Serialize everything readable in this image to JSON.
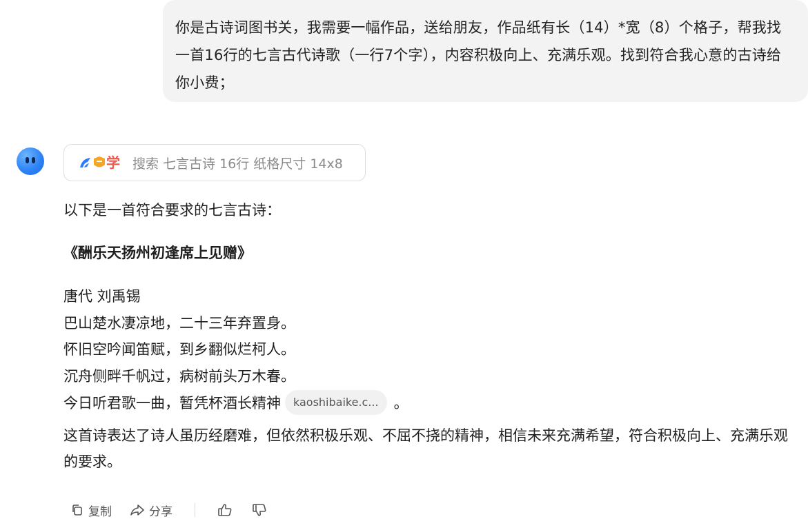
{
  "user_message": {
    "text": "你是古诗词图书关，我需要一幅作品，送给朋友，作品纸有长（14）*宽（8）个格子，帮我找一首16行的七言古代诗歌（一行7个字），内容积极向上、充满乐观。找到符合我心意的古诗给你小费；"
  },
  "search_chip": {
    "logo_char": "学",
    "text": "搜索 七言古诗 16行 纸格尺寸 14x8"
  },
  "answer": {
    "intro": "以下是一首符合要求的七言古诗：",
    "poem_title": "《酬乐天扬州初逢席上见赠》",
    "author": "唐代 刘禹锡",
    "lines": [
      "巴山楚水凄凉地，二十三年弃置身。",
      "怀旧空吟闻笛赋，到乡翻似烂柯人。",
      "沉舟侧畔千帆过，病树前头万木春。",
      "今日听君歌一曲，暂凭杯酒长精神"
    ],
    "source_chip": "kaoshibaike.c...",
    "last_punct": "。",
    "summary": "这首诗表达了诗人虽历经磨难，但依然积极乐观、不屈不挠的精神，相信未来充满希望，符合积极向上、充满乐观的要求。"
  },
  "actions": {
    "copy_label": "复制",
    "share_label": "分享"
  },
  "icons": {
    "copy": "copy-icon",
    "share": "share-icon",
    "like": "thumbs-up-icon",
    "dislike": "thumbs-down-icon"
  },
  "colors": {
    "avatar": "#2f84f6",
    "logo_blue": "#2f7df6",
    "logo_orange": "#f5a623",
    "logo_red": "#f2574b"
  }
}
